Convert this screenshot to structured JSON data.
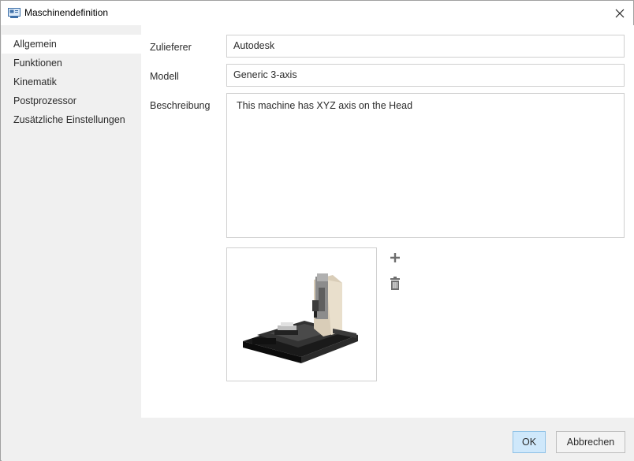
{
  "window": {
    "title": "Maschinendefinition",
    "icon": "machine-window-icon",
    "close_icon": "close-icon"
  },
  "sidebar": {
    "items": [
      {
        "label": "Allgemein",
        "active": true
      },
      {
        "label": "Funktionen",
        "active": false
      },
      {
        "label": "Kinematik",
        "active": false
      },
      {
        "label": "Postprozessor",
        "active": false
      },
      {
        "label": "Zusätzliche Einstellungen",
        "active": false
      }
    ]
  },
  "form": {
    "vendor_label": "Zulieferer",
    "vendor_value": "Autodesk",
    "model_label": "Modell",
    "model_value": "Generic 3-axis",
    "description_label": "Beschreibung",
    "description_value": "This machine has XYZ axis on the Head"
  },
  "image_actions": {
    "add_icon": "plus-icon",
    "delete_icon": "trash-icon"
  },
  "footer": {
    "ok_label": "OK",
    "cancel_label": "Abbrechen"
  },
  "colors": {
    "ok_button_bg": "#cfe8fb",
    "ok_button_border": "#8fc1e6",
    "sidebar_active_bg": "#ffffff",
    "panel_bg": "#f0f0f0"
  }
}
